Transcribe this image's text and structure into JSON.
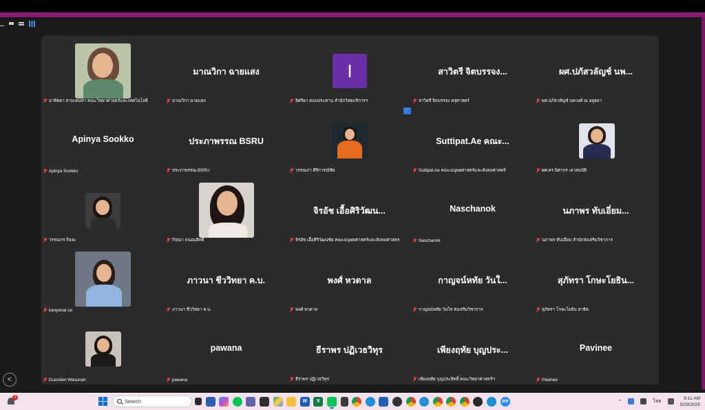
{
  "participants": [
    {
      "name": "",
      "label": "อาทิตยา สามเดนทา คณะวิทยาศาสตร์และเทคโนโลยี",
      "has_video": true
    },
    {
      "name": "มาณวิกา ฉายแสง",
      "label": "มาณวิกา ฉายแสง",
      "has_video": false
    },
    {
      "name": "",
      "label": "อิศริยา ดอนประทาน สำนักวิทยบริการฯ",
      "has_video": false,
      "avatar_letter": "I"
    },
    {
      "name": "สาวิตรี จิตบรรจง...",
      "label": "สาวิตรี จิตบรรจง ครุศาสตร์",
      "has_video": false
    },
    {
      "name": "ผศ.ปภัสวลัญช์ นพ...",
      "label": "ผศ.ปภัสวลัญช์ นพวงศ์ ณ อยุธยา",
      "has_video": false
    },
    {
      "name": "Apinya Sookko",
      "label": "Apinya Sookko",
      "has_video": false
    },
    {
      "name": "ประภาพรรณ BSRU",
      "label": "ประภาพรรณ BSRU",
      "has_video": false
    },
    {
      "name": "",
      "label": "วรรณภา ศิริการณ์ชัย",
      "has_video": true
    },
    {
      "name": "Suttipat.Ae คณะ...",
      "label": "Suttipat.Ae คณะมนุษยศาสตร์และสังคมศาสตร์",
      "has_video": false
    },
    {
      "name": "",
      "label": "ผศ.ดร.นิศากร เลาสมบัติ",
      "has_video": true
    },
    {
      "name": "",
      "label": "วรรณกร กิจจะ",
      "has_video": true
    },
    {
      "name": "",
      "label": "กิจณา ถนอมสิทธิ์",
      "has_video": true
    },
    {
      "name": "จิรอัช เอื้อศิริวัฒน...",
      "label": "จิรอัช เอื้อศิริวัฒนชัย คณะมนุษยศาสตร์และสังคมศาสตร",
      "has_video": false
    },
    {
      "name": "Naschanok",
      "label": "Naschanok",
      "has_video": false
    },
    {
      "name": "นภาพร ทับเอี่ยม...",
      "label": "นภาพร ทับเอี่ยม สำนักส่งเสริมวิชาการ",
      "has_video": false
    },
    {
      "name": "",
      "label": "kanyanat se",
      "has_video": true
    },
    {
      "name": "ภาวนา ชีววิทยา ค.บ.",
      "label": "ภาวนา ชีววิทยา ค.บ.",
      "has_video": false
    },
    {
      "name": "พงศ์ หวดาล",
      "label": "พงศ์ หวดาล",
      "has_video": false
    },
    {
      "name": "กาญจน์หทัย วันใ...",
      "label": "กาญจน์หทัย วันใส ส่งเสริมวิชาการ",
      "has_video": false
    },
    {
      "name": "สุภัทรา โกษะโยธิน...",
      "label": "สุภัทรา โกษะโยธิน สาธิต",
      "has_video": false
    },
    {
      "name": "",
      "label": "Duanden Wasunan",
      "has_video": true
    },
    {
      "name": "pawana",
      "label": "pawana",
      "has_video": false
    },
    {
      "name": "ธีราพร ปฏิเวธวิทุร",
      "label": "ธีราพร ปฏิเวธวิทุร",
      "has_video": false
    },
    {
      "name": "เพียงฤทัย บุญประ...",
      "label": "เพียงฤทัย บุญประสิทธิ์ คณะวิทยาศาสตร์ฯ",
      "has_video": false
    },
    {
      "name": "Pavinee",
      "label": "Pavinee",
      "has_video": false
    }
  ],
  "avatar_letter": "I",
  "more_button": "···",
  "back_button": "<",
  "taskbar": {
    "search_placeholder": "Search",
    "notification_count": "3",
    "language": "ไทย",
    "time": "9:11 AM",
    "date": "5/29/2025"
  },
  "colors": {
    "accent_band": "#8b1a72",
    "avatar_purple": "#6b2ea8",
    "mute_red": "#e04040",
    "tile_bg": "#2b2b2b"
  }
}
